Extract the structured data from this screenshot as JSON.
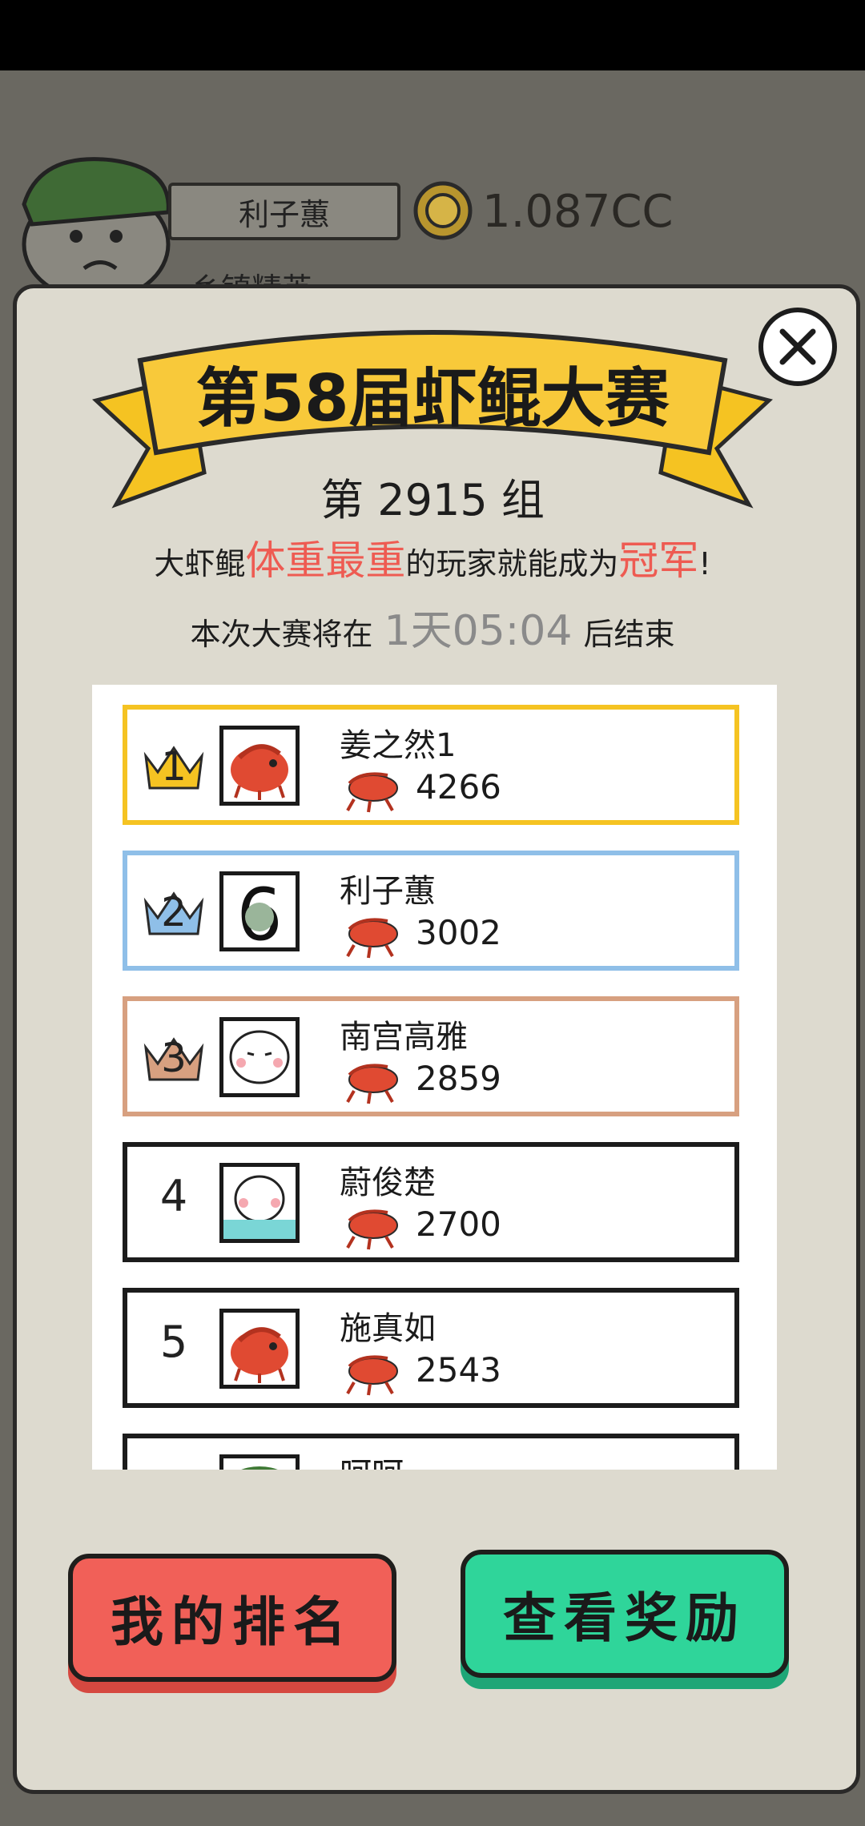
{
  "background": {
    "player_name": "利子蕙",
    "player_title": "乡镇精英",
    "coins": "1.087CC"
  },
  "modal": {
    "banner_title": "第58届虾鲲大赛",
    "group_prefix": "第",
    "group_number": "2915",
    "group_suffix": "组",
    "desc_part1": "大虾鲲",
    "desc_highlight1": "体重最重",
    "desc_part2": "的玩家就能成为",
    "desc_highlight2": "冠军",
    "desc_end": "!",
    "timer_prefix": "本次大赛将在",
    "timer_value": "1天05:04",
    "timer_suffix": "后结束"
  },
  "ranking": [
    {
      "rank": "1",
      "name": "姜之然1",
      "weight": "4266",
      "tier": "gold",
      "avatar": "shrimp-avatar"
    },
    {
      "rank": "2",
      "name": "利子蕙",
      "weight": "3002",
      "tier": "silver",
      "avatar": "meme-face-avatar"
    },
    {
      "rank": "3",
      "name": "南宫高雅",
      "weight": "2859",
      "tier": "bronze",
      "avatar": "blob-face-avatar"
    },
    {
      "rank": "4",
      "name": "蔚俊楚",
      "weight": "2700",
      "tier": "normal",
      "avatar": "crying-face-avatar"
    },
    {
      "rank": "5",
      "name": "施真如",
      "weight": "2543",
      "tier": "normal",
      "avatar": "shrimp-avatar"
    },
    {
      "rank": "",
      "name": "呵呵",
      "weight": "",
      "tier": "normal",
      "avatar": "green-avatar"
    }
  ],
  "buttons": {
    "my_rank": "我的排名",
    "view_rewards": "查看奖励"
  },
  "colors": {
    "gold": "#f5c322",
    "silver": "#8fbfe8",
    "bronze": "#d7a080",
    "highlight": "#ee5b52",
    "rank_button": "#f16058",
    "reward_button": "#2fd59a"
  }
}
